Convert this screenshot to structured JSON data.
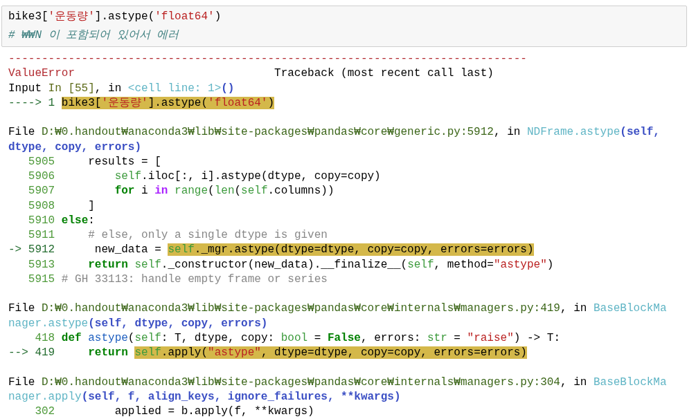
{
  "input_cell": {
    "lines": [
      [
        {
          "kind": "plain",
          "text": "bike3["
        },
        {
          "kind": "str",
          "text": "'운동량'"
        },
        {
          "kind": "plain",
          "text": "].astype("
        },
        {
          "kind": "str",
          "text": "'float64'"
        },
        {
          "kind": "plain",
          "text": ")"
        }
      ],
      [
        {
          "kind": "icomment",
          "text": "# ₩₩N 이 포함되어 있어서 에러"
        }
      ]
    ]
  },
  "output": {
    "lines": [
      {
        "kind": "rule",
        "tokens": [
          {
            "kind": "error",
            "text": "------------------------------------------------------------------------------"
          }
        ]
      },
      {
        "kind": "text",
        "tokens": [
          {
            "kind": "error",
            "text": "ValueError"
          },
          {
            "kind": "plain",
            "text": "                              Traceback (most recent call last)"
          }
        ]
      },
      {
        "kind": "text",
        "tokens": [
          {
            "kind": "plain",
            "text": "Input "
          },
          {
            "kind": "olive",
            "text": "In [55]"
          },
          {
            "kind": "plain",
            "text": ", in "
          },
          {
            "kind": "func",
            "text": "<cell line: 1>"
          },
          {
            "kind": "args",
            "text": "()"
          }
        ]
      },
      {
        "kind": "text",
        "tokens": [
          {
            "kind": "arrow",
            "text": "----> 1 ",
            "highlight": false
          },
          {
            "kind": "plain",
            "text": "bike3[",
            "highlight": true
          },
          {
            "kind": "str",
            "text": "'운동량'",
            "highlight": true
          },
          {
            "kind": "plain",
            "text": "].astype(",
            "highlight": true
          },
          {
            "kind": "str",
            "text": "'float64'",
            "highlight": true
          },
          {
            "kind": "plain",
            "text": ")",
            "highlight": true
          }
        ]
      },
      {
        "kind": "blank"
      },
      {
        "kind": "text",
        "tokens": [
          {
            "kind": "plain",
            "text": "File "
          },
          {
            "kind": "path",
            "text": "D:₩0.handout₩anaconda3₩lib₩site-packages₩pandas₩core₩generic.py:5912"
          },
          {
            "kind": "plain",
            "text": ", in "
          },
          {
            "kind": "func",
            "text": "NDFrame.astype"
          },
          {
            "kind": "args",
            "text": "(self,"
          }
        ]
      },
      {
        "kind": "text",
        "tokens": [
          {
            "kind": "args",
            "text": "dtype, copy, errors)"
          }
        ]
      },
      {
        "kind": "text",
        "tokens": [
          {
            "kind": "lineno",
            "text": "   5905"
          },
          {
            "kind": "plain",
            "text": "     results = ["
          }
        ]
      },
      {
        "kind": "text",
        "tokens": [
          {
            "kind": "lineno",
            "text": "   5906"
          },
          {
            "kind": "builtin",
            "text": "         self"
          },
          {
            "kind": "plain",
            "text": ".iloc[:, i].astype(dtype, copy=copy)"
          }
        ]
      },
      {
        "kind": "text",
        "tokens": [
          {
            "kind": "lineno",
            "text": "   5907"
          },
          {
            "kind": "kw",
            "text": "         for"
          },
          {
            "kind": "plain",
            "text": " i "
          },
          {
            "kind": "op",
            "text": "in"
          },
          {
            "kind": "builtin",
            "text": " range"
          },
          {
            "kind": "plain",
            "text": "("
          },
          {
            "kind": "builtin",
            "text": "len"
          },
          {
            "kind": "plain",
            "text": "("
          },
          {
            "kind": "builtin",
            "text": "self"
          },
          {
            "kind": "plain",
            "text": ".columns))"
          }
        ]
      },
      {
        "kind": "text",
        "tokens": [
          {
            "kind": "lineno",
            "text": "   5908"
          },
          {
            "kind": "plain",
            "text": "     ]"
          }
        ]
      },
      {
        "kind": "text",
        "tokens": [
          {
            "kind": "lineno",
            "text": "   5910"
          },
          {
            "kind": "kw",
            "text": " else"
          },
          {
            "kind": "plain",
            "text": ":"
          }
        ]
      },
      {
        "kind": "text",
        "tokens": [
          {
            "kind": "lineno",
            "text": "   5911"
          },
          {
            "kind": "comment",
            "text": "     # else, only a single dtype is given"
          }
        ]
      },
      {
        "kind": "text",
        "tokens": [
          {
            "kind": "arrow",
            "text": "-> 5912",
            "highlight": false
          },
          {
            "kind": "plain",
            "text": "      new_data = ",
            "highlight": false
          },
          {
            "kind": "builtin",
            "text": "self",
            "highlight": true
          },
          {
            "kind": "plain",
            "text": "._mgr.astype(dtype=dtype, copy=copy, errors=errors)",
            "highlight": true
          }
        ]
      },
      {
        "kind": "text",
        "tokens": [
          {
            "kind": "lineno",
            "text": "   5913"
          },
          {
            "kind": "kw",
            "text": "     return"
          },
          {
            "kind": "builtin",
            "text": " self"
          },
          {
            "kind": "plain",
            "text": "._constructor(new_data).__finalize__("
          },
          {
            "kind": "builtin",
            "text": "self"
          },
          {
            "kind": "plain",
            "text": ", method="
          },
          {
            "kind": "str",
            "text": "\"astype\""
          },
          {
            "kind": "plain",
            "text": ")"
          }
        ]
      },
      {
        "kind": "text",
        "tokens": [
          {
            "kind": "lineno",
            "text": "   5915"
          },
          {
            "kind": "comment",
            "text": " # GH 33113: handle empty frame or series"
          }
        ]
      },
      {
        "kind": "blank"
      },
      {
        "kind": "text",
        "tokens": [
          {
            "kind": "plain",
            "text": "File "
          },
          {
            "kind": "path",
            "text": "D:₩0.handout₩anaconda3₩lib₩site-packages₩pandas₩core₩internals₩managers.py:419"
          },
          {
            "kind": "plain",
            "text": ", in "
          },
          {
            "kind": "func",
            "text": "BaseBlockMa"
          }
        ]
      },
      {
        "kind": "text",
        "tokens": [
          {
            "kind": "func",
            "text": "nager.astype"
          },
          {
            "kind": "args",
            "text": "(self, dtype, copy, errors)"
          }
        ]
      },
      {
        "kind": "text",
        "tokens": [
          {
            "kind": "lineno",
            "text": "    418"
          },
          {
            "kind": "kw",
            "text": " def"
          },
          {
            "kind": "def",
            "text": " astype"
          },
          {
            "kind": "plain",
            "text": "("
          },
          {
            "kind": "builtin",
            "text": "self"
          },
          {
            "kind": "plain",
            "text": ": T, dtype, copy: "
          },
          {
            "kind": "builtin",
            "text": "bool"
          },
          {
            "kind": "plain",
            "text": " = "
          },
          {
            "kind": "kw",
            "text": "False"
          },
          {
            "kind": "plain",
            "text": ", errors: "
          },
          {
            "kind": "builtin",
            "text": "str"
          },
          {
            "kind": "plain",
            "text": " = "
          },
          {
            "kind": "str",
            "text": "\"raise\""
          },
          {
            "kind": "plain",
            "text": ") -> T:"
          }
        ]
      },
      {
        "kind": "text",
        "tokens": [
          {
            "kind": "arrow",
            "text": "--> 419",
            "highlight": false
          },
          {
            "kind": "kw",
            "text": "     return ",
            "highlight": false
          },
          {
            "kind": "builtin",
            "text": "self",
            "highlight": true
          },
          {
            "kind": "plain",
            "text": ".apply(",
            "highlight": true
          },
          {
            "kind": "str",
            "text": "\"astype\"",
            "highlight": true
          },
          {
            "kind": "plain",
            "text": ", dtype=dtype, copy=copy, errors=errors)",
            "highlight": true
          }
        ]
      },
      {
        "kind": "blank"
      },
      {
        "kind": "text",
        "tokens": [
          {
            "kind": "plain",
            "text": "File "
          },
          {
            "kind": "path",
            "text": "D:₩0.handout₩anaconda3₩lib₩site-packages₩pandas₩core₩internals₩managers.py:304"
          },
          {
            "kind": "plain",
            "text": ", in "
          },
          {
            "kind": "func",
            "text": "BaseBlockMa"
          }
        ]
      },
      {
        "kind": "text",
        "tokens": [
          {
            "kind": "func",
            "text": "nager.apply"
          },
          {
            "kind": "args",
            "text": "(self, f, align_keys, ignore_failures, **kwargs)"
          }
        ]
      },
      {
        "kind": "text",
        "tokens": [
          {
            "kind": "lineno",
            "text": "    302"
          },
          {
            "kind": "plain",
            "text": "         applied = b.apply(f, **kwargs)"
          }
        ]
      }
    ]
  }
}
